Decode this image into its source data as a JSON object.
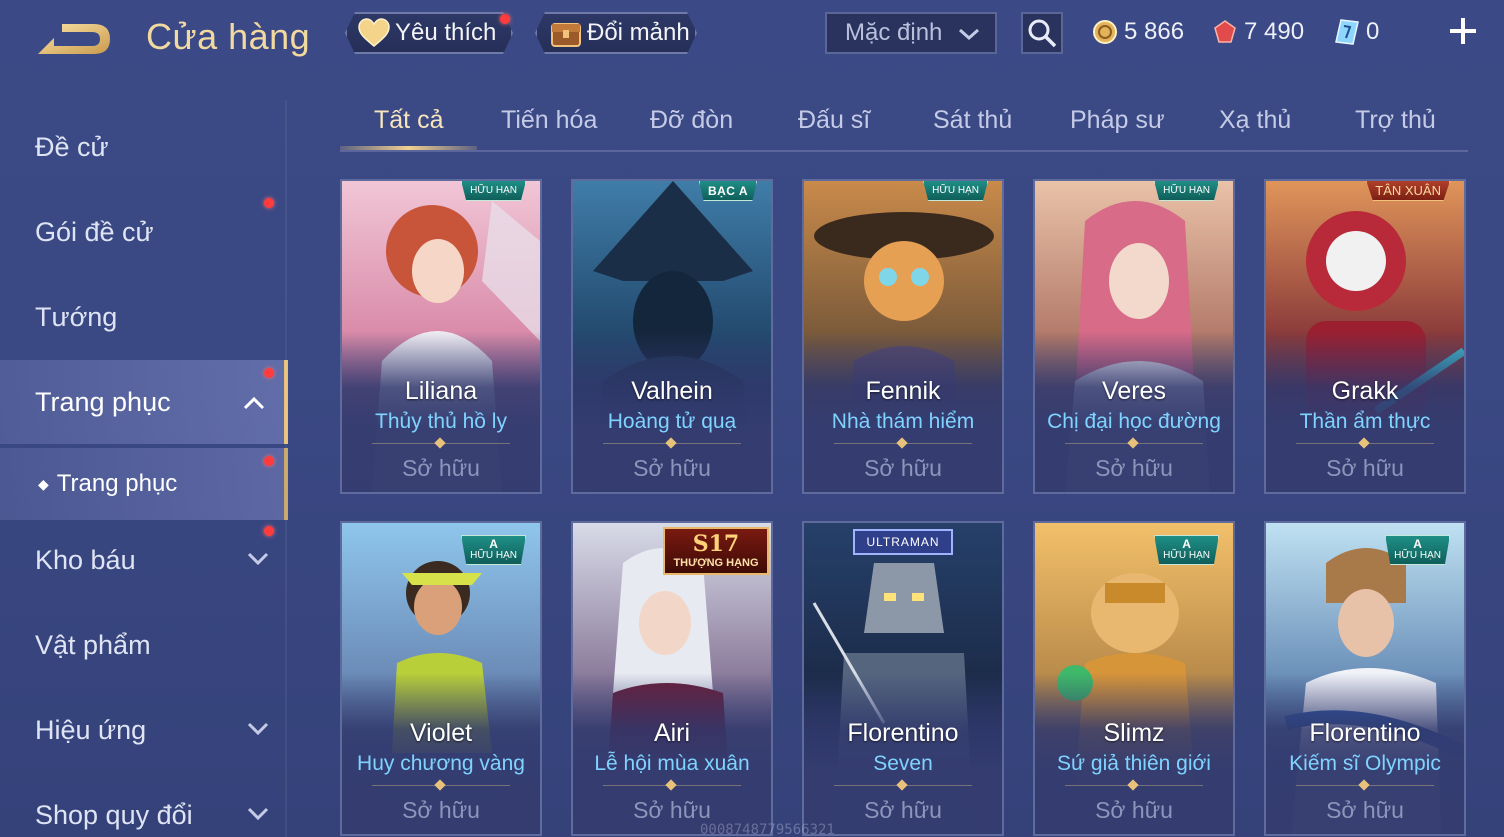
{
  "header": {
    "title": "Cửa hàng",
    "favorite_label": "Yêu thích",
    "shard_label": "Đổi mảnh",
    "sort_value": "Mặc định",
    "currencies": {
      "gold": "5 866",
      "ruby": "7 490",
      "voucher": "0"
    }
  },
  "sidebar": {
    "items": [
      {
        "label": "Đề cử"
      },
      {
        "label": "Gói đề cử"
      },
      {
        "label": "Tướng"
      },
      {
        "label": "Trang phục"
      },
      {
        "label": "Trang phục"
      },
      {
        "label": "Kho báu"
      },
      {
        "label": "Vật phẩm"
      },
      {
        "label": "Hiệu ứng"
      },
      {
        "label": "Shop quy đổi"
      }
    ]
  },
  "tabs": [
    "Tất cả",
    "Tiến hóa",
    "Đỡ đòn",
    "Đấu sĩ",
    "Sát thủ",
    "Pháp sư",
    "Xạ thủ",
    "Trợ thủ"
  ],
  "cards": [
    {
      "hero": "Liliana",
      "skin": "Thủy thủ hồ ly",
      "status": "Sở hữu",
      "badge": "HỮU HẠN"
    },
    {
      "hero": "Valhein",
      "skin": "Hoàng tử quạ",
      "status": "Sở hữu",
      "badge": "BẠC A"
    },
    {
      "hero": "Fennik",
      "skin": "Nhà thám hiểm",
      "status": "Sở hữu",
      "badge": "HỮU HẠN"
    },
    {
      "hero": "Veres",
      "skin": "Chị đại học đường",
      "status": "Sở hữu",
      "badge": "HỮU HẠN"
    },
    {
      "hero": "Grakk",
      "skin": "Thần ẩm thực",
      "status": "Sở hữu",
      "badge": "TÂN XUÂN"
    },
    {
      "hero": "Violet",
      "skin": "Huy chương vàng",
      "status": "Sở hữu",
      "badge_tier": "A",
      "badge": "HỮU HẠN"
    },
    {
      "hero": "Airi",
      "skin": "Lễ hội mùa xuân",
      "status": "Sở hữu",
      "badge_tier": "S17",
      "badge": "THƯỢNG HẠNG"
    },
    {
      "hero": "Florentino",
      "skin": "Seven",
      "status": "Sở hữu",
      "badge": "ULTRAMAN"
    },
    {
      "hero": "Slimz",
      "skin": "Sứ giả thiên giới",
      "status": "Sở hữu",
      "badge_tier": "A",
      "badge": "HỮU HẠN"
    },
    {
      "hero": "Florentino",
      "skin": "Kiếm sĩ Olympic",
      "status": "Sở hữu",
      "badge_tier": "A",
      "badge": "HỮU HẠN"
    }
  ],
  "watermark": "0008748779566321",
  "colors": {
    "accent_gold": "#f2d9a0",
    "skin_name": "#7fd3ff",
    "notification": "#ff3b3b",
    "background": "#3b4a86"
  }
}
